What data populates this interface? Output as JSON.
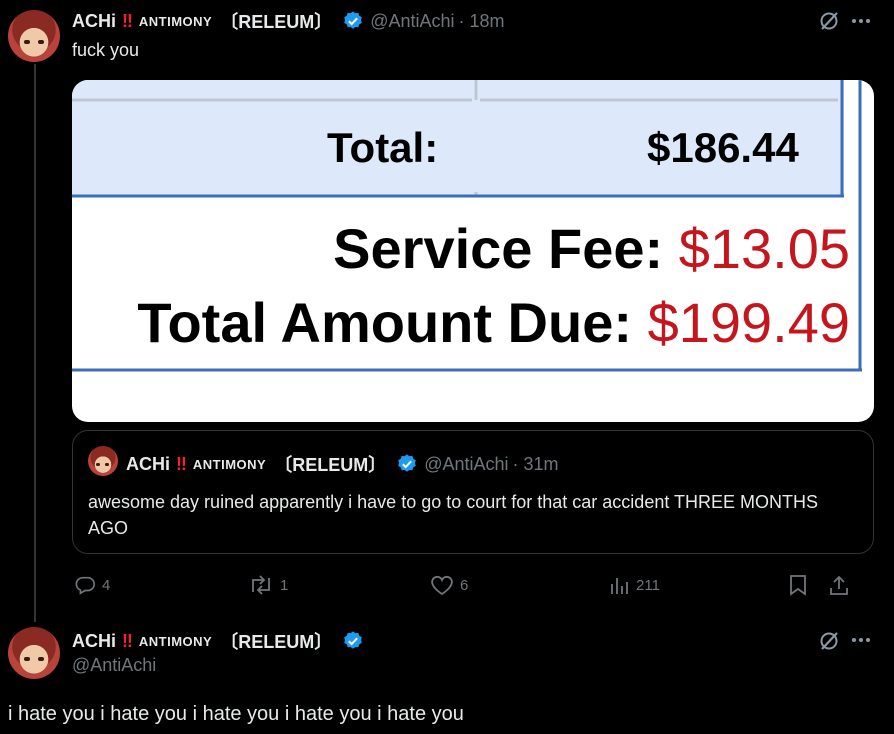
{
  "tweet1": {
    "display_name": "ACHi",
    "bang": "‼",
    "tag": "ANTIMONY",
    "releum": "〔RELEUM〕",
    "handle": "@AntiAchi",
    "time": "· 18m",
    "text": "fuck you"
  },
  "media": {
    "total_label": "Total:",
    "total_value": "$186.44",
    "service_fee_label": "Service Fee:",
    "service_fee_value": "$13.05",
    "amount_due_label": "Total Amount Due:",
    "amount_due_value": "$199.49"
  },
  "quote": {
    "display_name": "ACHi",
    "bang": "‼",
    "tag": "ANTIMONY",
    "releum": "〔RELEUM〕",
    "handle": "@AntiAchi",
    "time": "· 31m",
    "text": "awesome day ruined apparently i have to go to court for that car accident THREE MONTHS AGO"
  },
  "actions": {
    "replies": "4",
    "reposts": "1",
    "likes": "6",
    "views": "211"
  },
  "tweet2": {
    "display_name": "ACHi",
    "bang": "‼",
    "tag": "ANTIMONY",
    "releum": "〔RELEUM〕",
    "handle": "@AntiAchi",
    "text": "i hate you i hate you i hate you i hate you i hate you"
  },
  "colors": {
    "background": "#000000",
    "text": "#e7e9ea",
    "muted": "#71767b",
    "verified": "#1d9bf0",
    "bang": "#f4212e",
    "receipt_red": "#c4161c",
    "receipt_blue": "#3a6fb8",
    "receipt_fill": "#dde8fb"
  }
}
